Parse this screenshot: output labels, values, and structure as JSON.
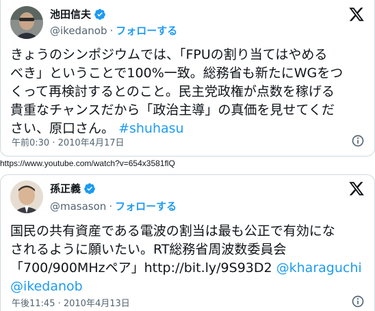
{
  "tweet1": {
    "name": "池田信夫",
    "handle": "@ikedanob",
    "separator": "·",
    "follow_label": "フォローする",
    "text_lines": [
      "きょうのシンポジウムでは、「FPUの割り当てはやめる",
      "べき」ということで100%一致。総務省も新たにWGをつ",
      "くって再検討するとのこと。民主党政権が点数を稼げる",
      "貴重なチャンスだから「政治主導」の真価を見せてくだ"
    ],
    "text_last_prefix": "さい、原口さん。",
    "hashtag": "#shuhasu",
    "timestamp": "午前0:30 · 2010年4月17日"
  },
  "url_line": "https://www.youtube.com/watch?v=654x3581flQ",
  "tweet2": {
    "name": "孫正義",
    "handle": "@masason",
    "separator": "·",
    "follow_label": "フォローする",
    "text_lines": [
      "国民の共有資産である電波の割当は最も公正で有効にな",
      "されるように願いたい。RT総務省周波数委員会"
    ],
    "text_line3_prefix": "「700/900MHzペア」http://bit.ly/9S93D2",
    "mention1": "@kharaguchi",
    "mention2": "@ikedanob",
    "timestamp": "午後11:45 · 2010年4月13日"
  },
  "colors": {
    "accent": "#1d9bf0",
    "text": "#0f1419",
    "secondary": "#536471",
    "border": "#cfd9de"
  },
  "icons": [
    "verified-badge-icon",
    "x-logo-icon",
    "info-icon"
  ]
}
